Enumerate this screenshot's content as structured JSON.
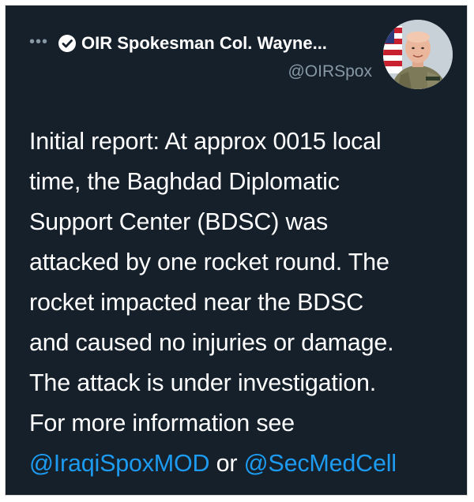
{
  "author": {
    "display_name": "OIR Spokesman Col. Wayne...",
    "handle": "@OIRSpox",
    "more_glyph": "•••"
  },
  "tweet": {
    "lines": [
      "Initial report: At approx 0015 local",
      "time, the Baghdad Diplomatic",
      "Support Center (BDSC) was",
      "attacked by one rocket round. The",
      "rocket impacted near the BDSC",
      "and caused no injuries or damage.",
      "The attack is under investigation.",
      "For more information see"
    ],
    "mention_1": "@IraqiSpoxMOD",
    "connector": "or",
    "mention_2": "@SecMedCell"
  },
  "colors": {
    "background": "#15202b",
    "text": "#ffffff",
    "muted": "#8899a6",
    "link": "#1d9bf0"
  }
}
